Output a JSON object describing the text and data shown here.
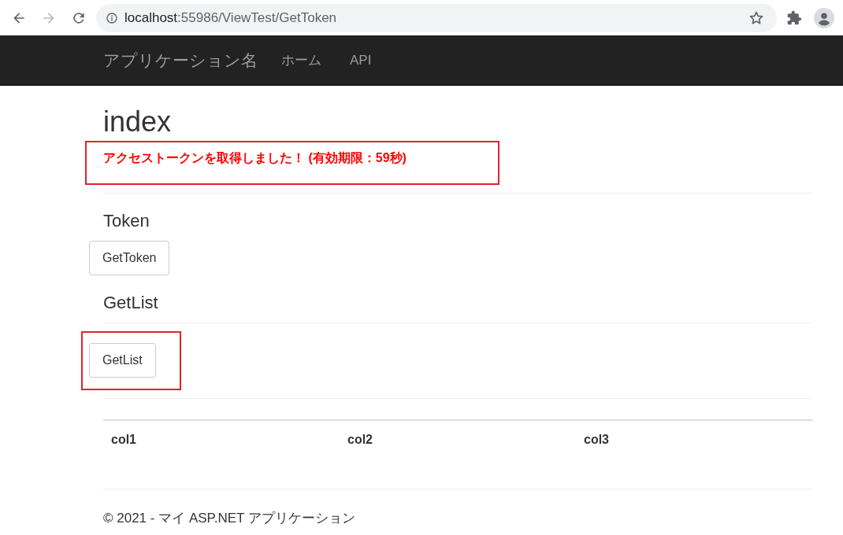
{
  "browser": {
    "url_host": "localhost",
    "url_path": ":55986/ViewTest/GetToken",
    "back_disabled": false,
    "forward_disabled": true
  },
  "navbar": {
    "brand": "アプリケーション名",
    "links": [
      "ホーム",
      "API"
    ]
  },
  "page": {
    "title": "index",
    "message": {
      "text": "アクセストークンを取得しました！ (有効期限：59秒)",
      "highlighted": true
    },
    "sections": [
      {
        "heading": "Token",
        "divider_below_heading": false,
        "button": {
          "label": "GetToken",
          "highlighted": false
        }
      },
      {
        "heading": "GetList",
        "divider_below_heading": true,
        "button": {
          "label": "GetList",
          "highlighted": true
        }
      }
    ],
    "table": {
      "columns": [
        "col1",
        "col2",
        "col3"
      ]
    }
  },
  "footer": "© 2021 - マイ ASP.NET アプリケーション"
}
